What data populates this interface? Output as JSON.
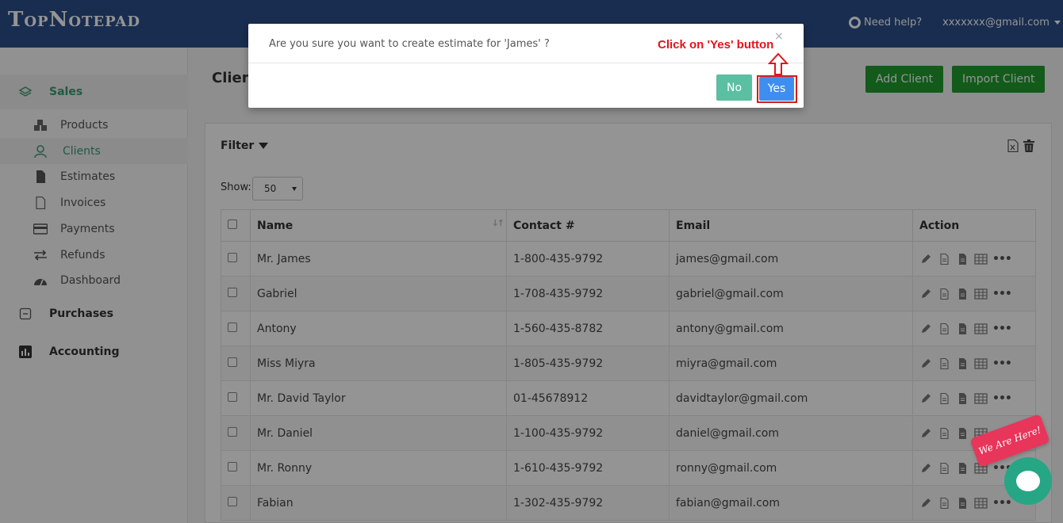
{
  "header": {
    "logo": "TopNotepad",
    "help_label": "Need help?",
    "user_email": "xxxxxxx@gmail.com"
  },
  "sidebar": {
    "sections": [
      {
        "label": "Sales",
        "icon": "layers-icon"
      },
      {
        "label": "Purchases",
        "icon": "minus-square-icon"
      },
      {
        "label": "Accounting",
        "icon": "bar-chart-icon"
      }
    ],
    "items": [
      {
        "label": "Products",
        "icon": "cubes-icon"
      },
      {
        "label": "Clients",
        "icon": "user-icon"
      },
      {
        "label": "Estimates",
        "icon": "file-icon"
      },
      {
        "label": "Invoices",
        "icon": "file-outline-icon"
      },
      {
        "label": "Payments",
        "icon": "credit-card-icon"
      },
      {
        "label": "Refunds",
        "icon": "exchange-icon"
      },
      {
        "label": "Dashboard",
        "icon": "dashboard-icon"
      }
    ]
  },
  "main": {
    "title": "Client",
    "add_client": "Add Client",
    "import_client": "Import Client",
    "filter_label": "Filter",
    "show_label": "Show:",
    "show_value": "50",
    "columns": [
      "Name",
      "Contact #",
      "Email",
      "Action"
    ],
    "rows": [
      {
        "name": "Mr. James",
        "contact": "1-800-435-9792",
        "email": "james@gmail.com"
      },
      {
        "name": "Gabriel",
        "contact": "1-708-435-9792",
        "email": "gabriel@gmail.com"
      },
      {
        "name": "Antony",
        "contact": "1-560-435-8782",
        "email": "antony@gmail.com"
      },
      {
        "name": "Miss Miyra",
        "contact": "1-805-435-9792",
        "email": "miyra@gmail.com"
      },
      {
        "name": "Mr. David Taylor",
        "contact": "01-45678912",
        "email": "davidtaylor@gmail.com"
      },
      {
        "name": "Mr. Daniel",
        "contact": "1-100-435-9792",
        "email": "daniel@gmail.com"
      },
      {
        "name": "Mr. Ronny",
        "contact": "1-610-435-9792",
        "email": "ronny@gmail.com"
      },
      {
        "name": "Fabian",
        "contact": "1-302-435-9792",
        "email": "fabian@gmail.com"
      }
    ]
  },
  "modal": {
    "message": "Are you sure you want to create estimate for 'James' ?",
    "close": "×",
    "no_label": "No",
    "yes_label": "Yes"
  },
  "annotation": {
    "text": "Click on 'Yes' button"
  },
  "chat": {
    "ribbon": "We Are Here!"
  },
  "colors": {
    "topbar": "#2c4f8b",
    "accent_green": "#3a9b73",
    "button_green": "#1f9d2f",
    "yes_blue": "#3d8ef0",
    "no_teal": "#5bbfa2",
    "annotation_red": "#e4141b"
  }
}
